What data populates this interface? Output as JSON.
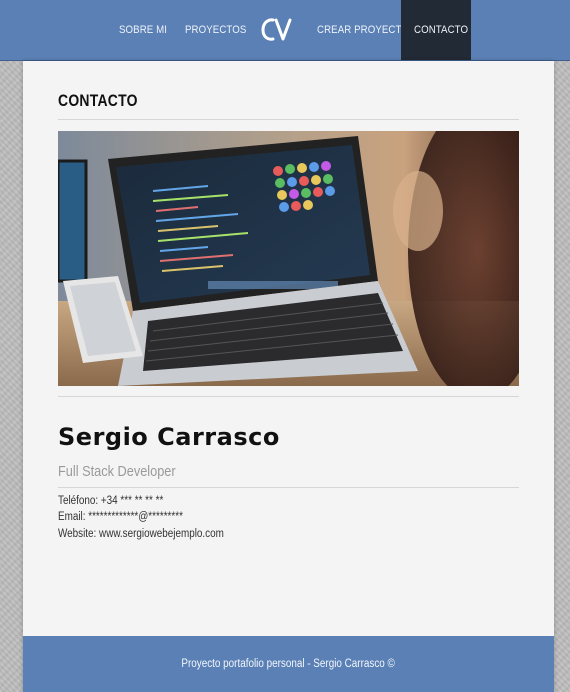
{
  "nav": {
    "items": [
      {
        "label": "SOBRE MI"
      },
      {
        "label": "PROYECTOS"
      },
      {
        "label": "CREAR PROYECTO"
      },
      {
        "label": "CONTACTO",
        "active": true
      }
    ],
    "logo": "CV"
  },
  "colors": {
    "nav_bg": "#5b80b5",
    "active_bg": "#222a35",
    "page_bg": "#f4f4f4"
  },
  "main": {
    "title": "CONTACTO",
    "hero_icon": "laptop-coding-photo",
    "name": "Sergio Carrasco",
    "role": "Full Stack Developer",
    "phone_label": "Teléfono:",
    "phone_value": "+34 *** ** ** **",
    "email_label": "Email:",
    "email_value": "*************@*********",
    "website_label": "Website:",
    "website_value": "www.sergiowebejemplo.com"
  },
  "footer": {
    "text": "Proyecto portafolio personal - Sergio Carrasco ©"
  }
}
